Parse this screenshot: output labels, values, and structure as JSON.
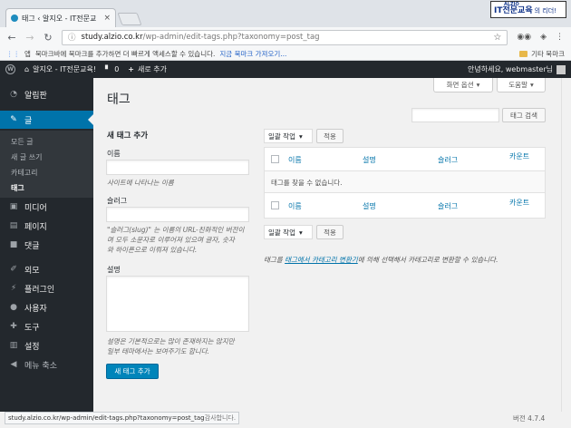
{
  "browser": {
    "tab_title": "태그 ‹ 알지오 - IT전문교",
    "brand_small": "ALZIO",
    "brand_main": "IT전문교육",
    "brand_rest": "의 리더!",
    "url_domain": "study.alzio.co.kr",
    "url_path": "/wp-admin/edit-tags.php?taxonomy=post_tag",
    "bookmarks_apps": "앱",
    "bookmarks_text": "북마크바에 북마크를 추가하면 더 빠르게 액세스할 수 있습니다.",
    "bookmarks_link": "지금 북마크 가져오기...",
    "bookmarks_other": "기타 북마크"
  },
  "adminbar": {
    "site_name": "알지오 - IT전문교육!",
    "comments_count": "0",
    "new_label": "새로 추가",
    "greeting": "안녕하세요, webmaster님"
  },
  "sidebar": {
    "items": [
      {
        "label": "알림판",
        "icon": "dashboard-icon"
      },
      {
        "label": "글",
        "icon": "pin-icon"
      },
      {
        "label": "미디어",
        "icon": "media-icon"
      },
      {
        "label": "페이지",
        "icon": "page-icon"
      },
      {
        "label": "댓글",
        "icon": "comment-icon"
      },
      {
        "label": "외모",
        "icon": "brush-icon"
      },
      {
        "label": "플러그인",
        "icon": "plugin-icon"
      },
      {
        "label": "사용자",
        "icon": "user-icon"
      },
      {
        "label": "도구",
        "icon": "wrench-icon"
      },
      {
        "label": "설정",
        "icon": "settings-icon"
      },
      {
        "label": "메뉴 축소",
        "icon": "collapse-icon"
      }
    ],
    "sub": [
      "모든 글",
      "새 글 쓰기",
      "카테고리",
      "태그"
    ]
  },
  "page": {
    "title": "태그",
    "screen_options": "화면 옵션",
    "help": "도움말",
    "search_button": "태그 검색"
  },
  "form": {
    "heading": "새 태그 추가",
    "name_label": "이름",
    "name_help": "사이트에 나타나는 이름",
    "slug_label": "슬러그",
    "slug_help_1": "\"슬러그(slug)\" 는 이름의 URL-친화적인 버전이",
    "slug_help_2": "며 모두 소문자로 이루어져 있으며 글자, 숫자",
    "slug_help_3": "와 하이픈으로 이뤄져 있습니다.",
    "desc_label": "설명",
    "desc_help_1": "설명은 기본적으로는 많이 존재하지는 않지만",
    "desc_help_2": "일부 테마에서는 보여주기도 합니다.",
    "submit": "새 태그 추가"
  },
  "table": {
    "bulk_action": "일괄 작업",
    "apply": "적용",
    "columns": [
      "이름",
      "설명",
      "슬러그",
      "카운트"
    ],
    "empty": "태그를 찾을 수 없습니다."
  },
  "note": {
    "prefix": "태그를 ",
    "link": "태그에서 카테고리 변환기",
    "suffix": "에 의해 선택해서 카테고리로 변환할 수 있습니다."
  },
  "status": {
    "url": "study.alzio.co.kr/wp-admin/edit-tags.php?taxonomy=post_tag",
    "suffix": " 감사합니다.",
    "version": "버전 4.7.4"
  }
}
